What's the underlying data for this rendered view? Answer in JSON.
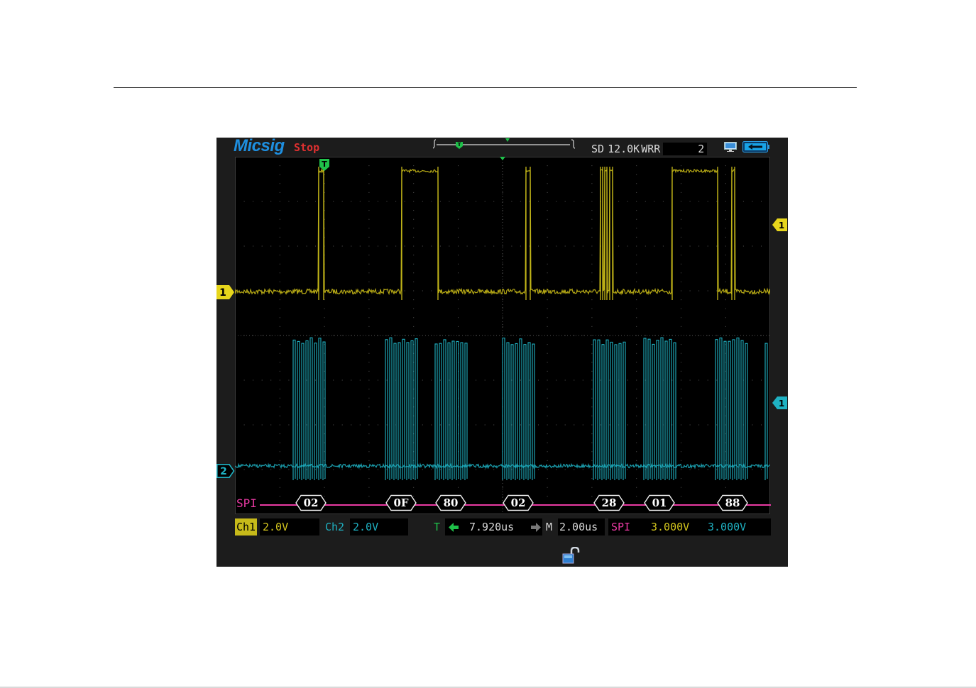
{
  "brand": "Micsig",
  "run_state": "Stop",
  "status": {
    "storage": "SD",
    "memory_depth": "12.0K",
    "acq_mode": "WRR",
    "count": "2"
  },
  "channels": {
    "ch1": {
      "label": "Ch1",
      "scale": "2.0V",
      "marker": "1",
      "color": "#d4c61e"
    },
    "ch2": {
      "label": "Ch2",
      "scale": "2.0V",
      "marker": "2",
      "color": "#1fb1c2"
    }
  },
  "trigger": {
    "label": "T",
    "position": "7.920us",
    "marker": "T",
    "color": "#1fc14a"
  },
  "timebase": {
    "label": "M",
    "value": "2.00us"
  },
  "spi": {
    "label": "SPI",
    "threshold_1": "3.000V",
    "threshold_2": "3.000V",
    "protocol_label": "SPI",
    "bytes": [
      "02",
      "0F",
      "80",
      "02",
      "28",
      "01",
      "88"
    ],
    "color": "#ea3aa3"
  },
  "icons": {
    "monitor": "monitor-icon",
    "battery": "battery-icon",
    "lock": "unlocked-padlock-icon",
    "trigger_left": "arrow-left-icon",
    "trigger_right": "arrow-right-icon"
  }
}
